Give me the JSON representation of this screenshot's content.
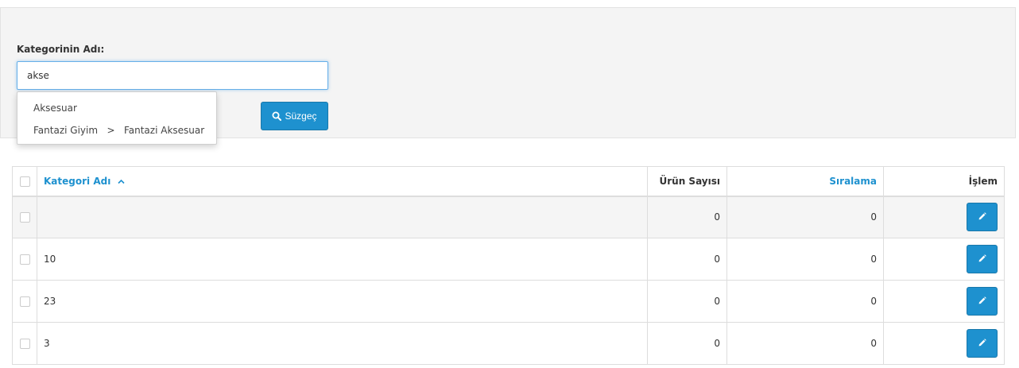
{
  "filter": {
    "label": "Kategorinin Adı:",
    "input_value": "akse",
    "button_label": "Süzgeç",
    "autocomplete": [
      "Aksesuar",
      "Fantazi Giyim   >   Fantazi Aksesuar"
    ]
  },
  "table": {
    "headers": {
      "name": "Kategori Adı",
      "products": "Ürün Sayısı",
      "sort": "Sıralama",
      "action": "İşlem"
    },
    "rows": [
      {
        "name": "",
        "products": "0",
        "sort": "0"
      },
      {
        "name": "10",
        "products": "0",
        "sort": "0"
      },
      {
        "name": "23",
        "products": "0",
        "sort": "0"
      },
      {
        "name": "3",
        "products": "0",
        "sort": "0"
      }
    ]
  },
  "colors": {
    "accent": "#1e91cf",
    "panel_bg": "#f4f4f4"
  },
  "icons": {
    "filter_button": "search-icon",
    "sort": "chevron-up-icon",
    "edit": "pencil-icon"
  }
}
